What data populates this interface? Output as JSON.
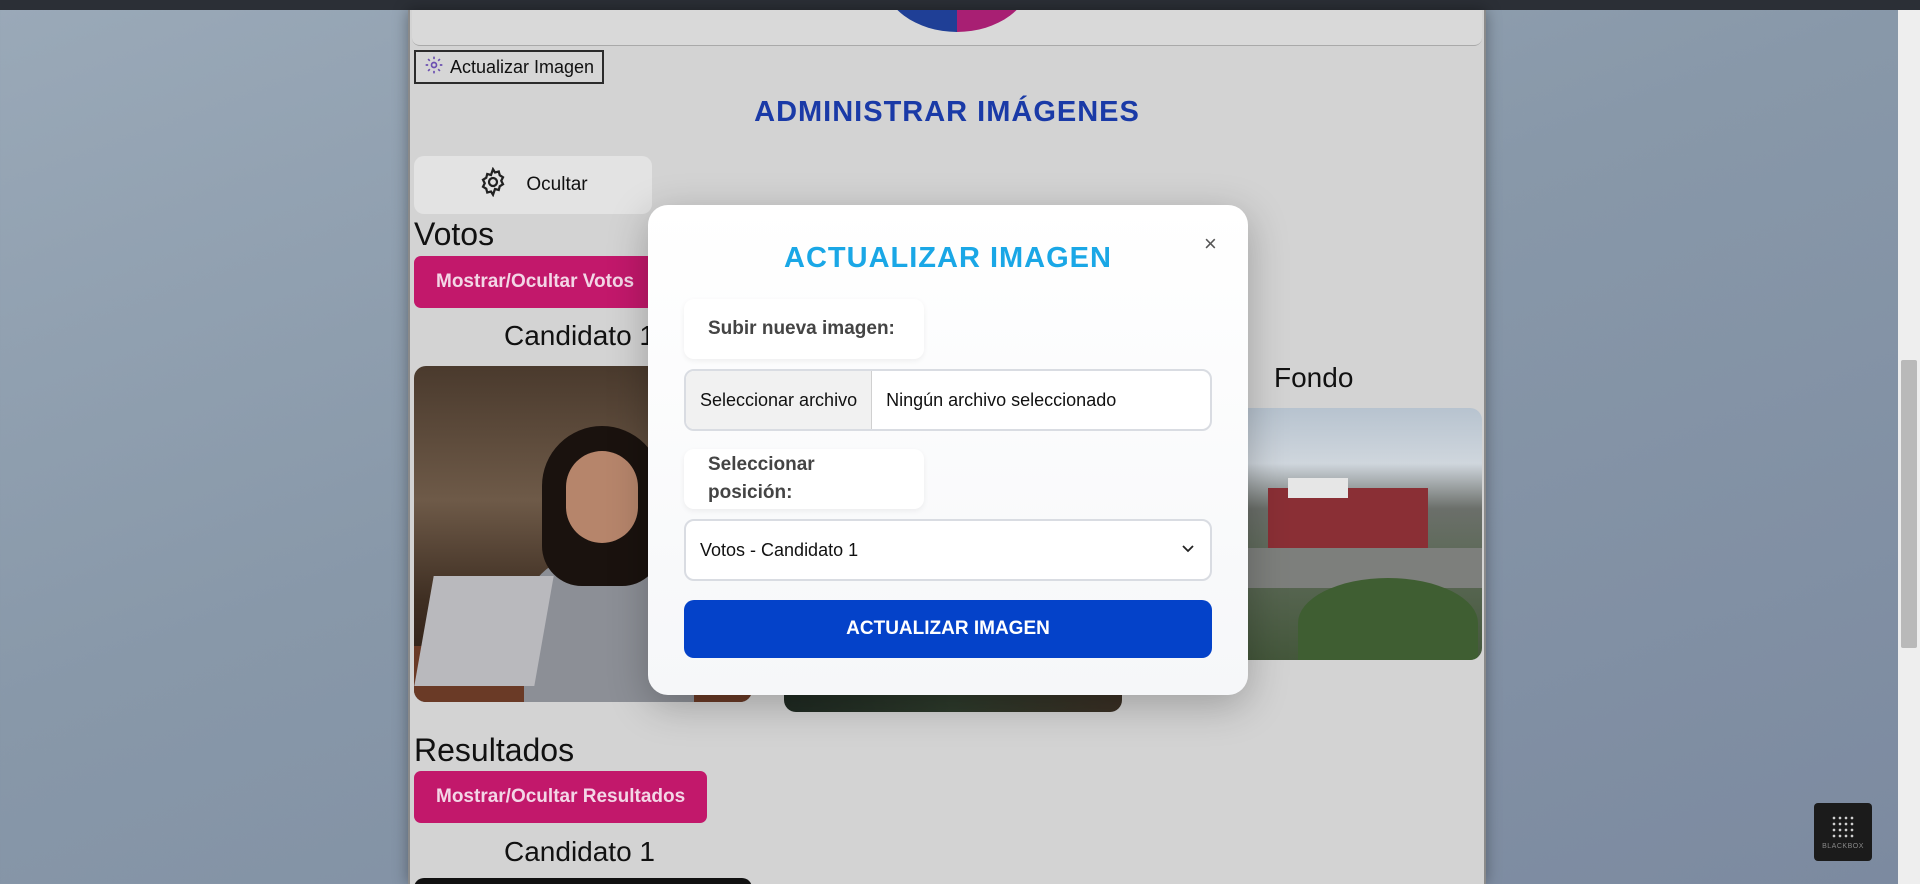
{
  "toolbar": {
    "update_image_label": "Actualizar Imagen"
  },
  "admin": {
    "title": "ADMINISTRAR IMÁGENES",
    "hide_label": "Ocultar"
  },
  "votes": {
    "title": "Votos",
    "toggle_label": "Mostrar/Ocultar Votos",
    "candidate_label": "Candidato 1"
  },
  "background": {
    "label": "Fondo"
  },
  "results": {
    "title": "Resultados",
    "toggle_label": "Mostrar/Ocultar Resultados",
    "candidate_label": "Candidato 1"
  },
  "modal": {
    "title": "ACTUALIZAR IMAGEN",
    "close_label": "×",
    "upload_label": "Subir nueva imagen:",
    "file_button_label": "Seleccionar archivo",
    "file_status": "Ningún archivo seleccionado",
    "position_label": "Seleccionar posición:",
    "position_selected": "Votos - Candidato 1",
    "submit_label": "ACTUALIZAR IMAGEN"
  },
  "watermark": {
    "text": "BLACKBOX"
  },
  "colors": {
    "accent_pink": "#c2186b",
    "primary_blue": "#0442c9",
    "title_blue": "#1a3aa7",
    "modal_title": "#1aa7e6"
  },
  "icons": {
    "gear": "gear-icon",
    "close": "close-icon",
    "chevron": "chevron-down-icon"
  }
}
